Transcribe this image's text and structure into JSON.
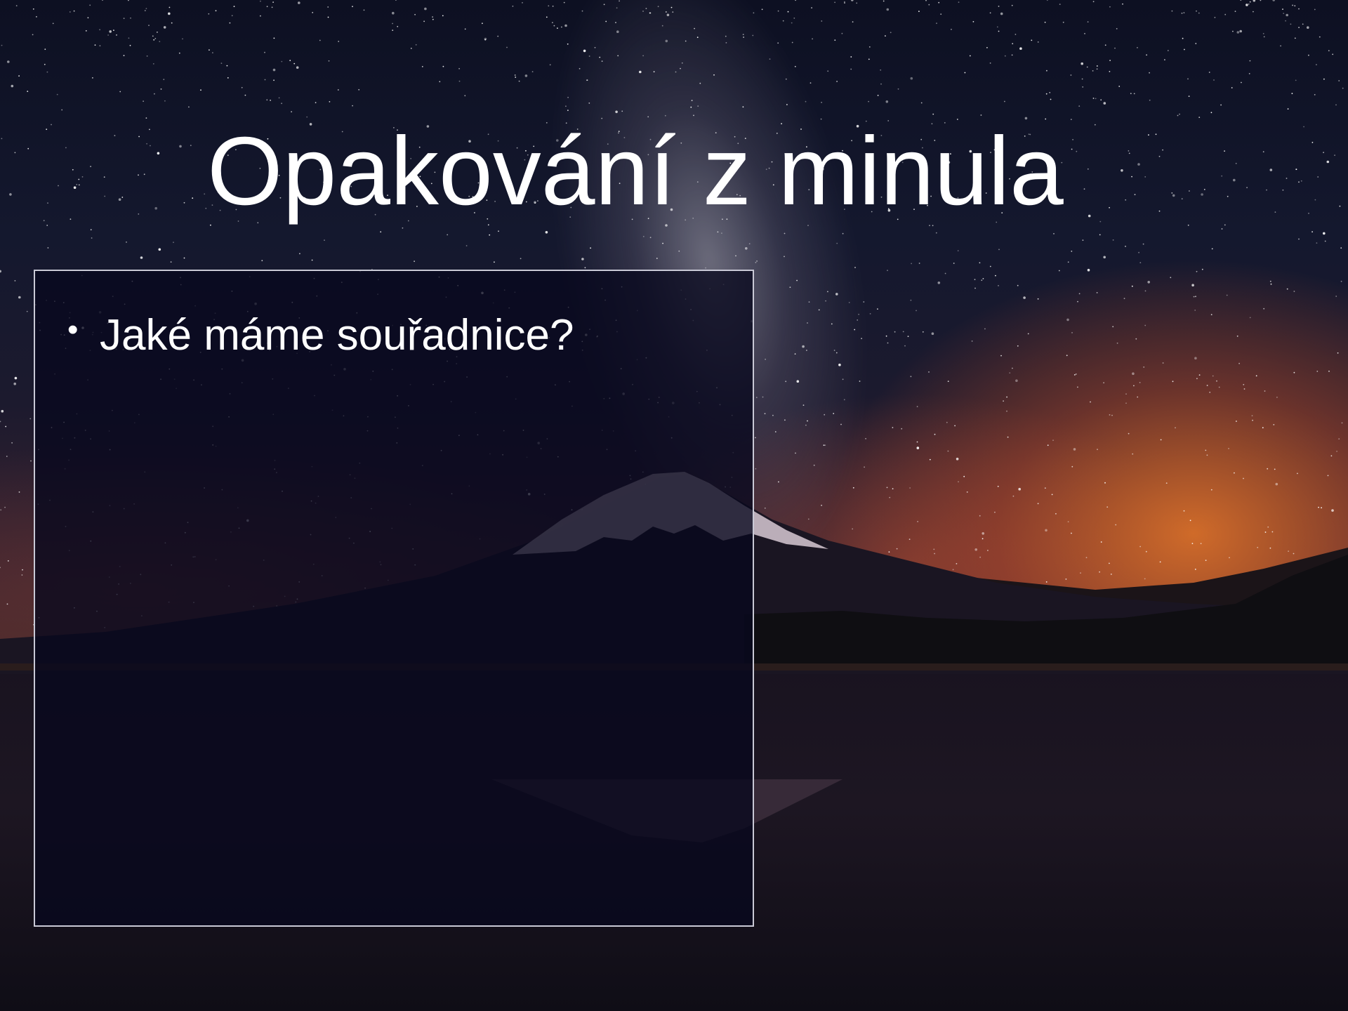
{
  "slide": {
    "title": "Opakování z minula",
    "bullets": [
      {
        "marker": "•",
        "text": "Jaké máme souřadnice?"
      }
    ]
  },
  "colors": {
    "title_text": "#ffffff",
    "panel_fill": "#08081e",
    "panel_border": "#c9c9d6",
    "horizon_glow": "#eb7828"
  }
}
